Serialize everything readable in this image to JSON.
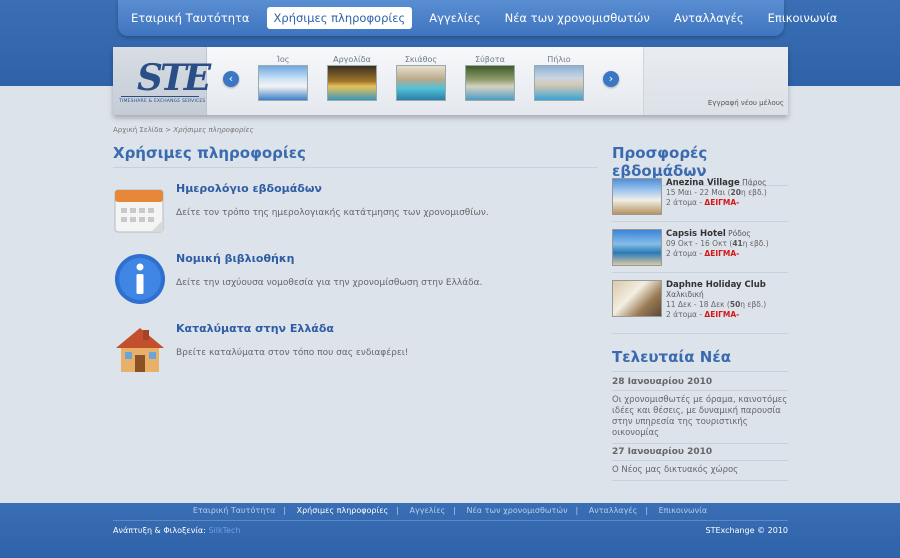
{
  "nav": {
    "items": [
      {
        "label": "Εταιρική Ταυτότητα"
      },
      {
        "label": "Χρήσιμες πληροφορίες"
      },
      {
        "label": "Αγγελίες"
      },
      {
        "label": "Νέα των χρονομισθωτών"
      },
      {
        "label": "Ανταλλαγές"
      },
      {
        "label": "Επικοινωνία"
      }
    ],
    "active_index": 1
  },
  "banner": {
    "logo_letters": "STE",
    "logo_subtitle": "TIMESHARE & EXCHANGE SERVICES",
    "destinations": [
      {
        "label": "Ίος"
      },
      {
        "label": "Αργολίδα"
      },
      {
        "label": "Σκιάθος"
      },
      {
        "label": "Σύβοτα"
      },
      {
        "label": "Πήλιο"
      }
    ],
    "register_link": "Εγγραφή νέου μέλους"
  },
  "breadcrumb": {
    "home": "Αρχική Σελίδα",
    "separator": ">",
    "current": "Χρήσιμες πληροφορίες"
  },
  "main": {
    "title": "Χρήσιμες πληροφορίες",
    "items": [
      {
        "title": "Ημερολόγιο εβδομάδων",
        "description": "Δείτε τον τρόπο της ημερολογιακής κατάτμησης των χρονομισθίων.",
        "icon": "calendar-icon"
      },
      {
        "title": "Νομική βιβλιοθήκη",
        "description": "Δείτε την ισχύουσα νομοθεσία για την χρονομίσθωση στην Ελλάδα.",
        "icon": "info-icon"
      },
      {
        "title": "Καταλύματα στην Ελλάδα",
        "description": "Βρείτε καταλύματα στον τόπο που σας ενδιαφέρει!",
        "icon": "house-icon"
      }
    ]
  },
  "offers": {
    "title": "Προσφορές εβδομάδων",
    "items": [
      {
        "name": "Anezina Village",
        "location": "Πάρος",
        "dates": "15 Μαι - 22 Μαι (",
        "nights": "20",
        "nights_suffix": "η εβδ.)",
        "persons": "2 άτομα - ",
        "price": "ΔΕΙΓΜΑ-"
      },
      {
        "name": "Capsis Hotel",
        "location": "Ρόδος",
        "dates": "09 Οκτ - 16 Οκτ (",
        "nights": "41",
        "nights_suffix": "η εβδ.)",
        "persons": "2 άτομα - ",
        "price": "ΔΕΙΓΜΑ-"
      },
      {
        "name": "Daphne Holiday Club",
        "location": "Χαλκιδική",
        "dates": "11 Δεκ - 18 Δεκ (",
        "nights": "50",
        "nights_suffix": "η εβδ.)",
        "persons": "2 άτομα - ",
        "price": "ΔΕΙΓΜΑ-"
      }
    ]
  },
  "news": {
    "title": "Τελευταία Νέα",
    "items": [
      {
        "date": "28 Ιανουαρίου 2010",
        "text": "Οι χρονομισθωτές με όραμα, καινοτόμες ιδέες και θέσεις, με δυναμική παρουσία στην υπηρεσία της τουριστικής οικονομίας"
      },
      {
        "date": "27 Ιανουαρίου 2010",
        "text": "Ο Νέος μας δικτυακός χώρος"
      }
    ]
  },
  "footer": {
    "nav": [
      "Εταιρική Ταυτότητα",
      "Χρήσιμες πληροφορίες",
      "Αγγελίες",
      "Νέα των χρονομισθωτών",
      "Ανταλλαγές",
      "Επικοινωνία"
    ],
    "separator": "|",
    "dev_label": "Ανάπτυξη & Φιλοξενία: ",
    "dev_name": "SilkTech",
    "copyright": "STExchange © 2010"
  },
  "colors": {
    "brand_blue": "#3a6fb5",
    "link_blue": "#2e5da3",
    "price_red": "#d41515"
  }
}
